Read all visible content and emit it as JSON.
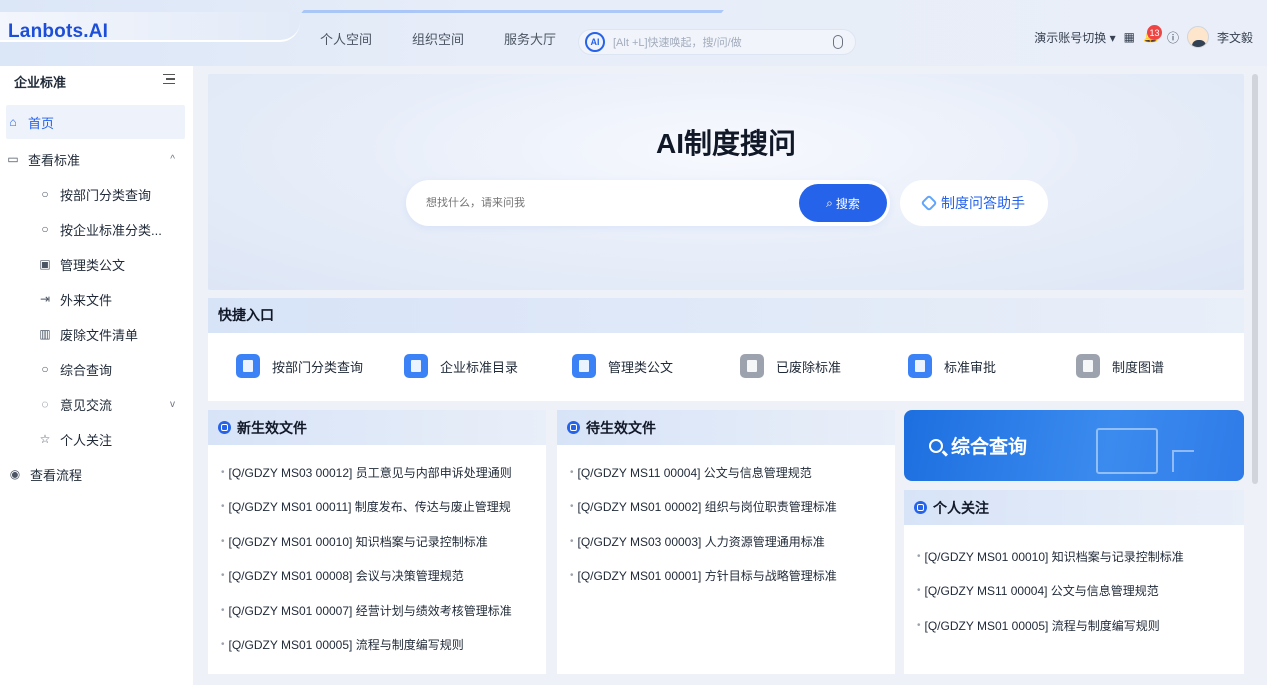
{
  "app": {
    "logo": "Lanbots.AI"
  },
  "topnav": {
    "items": [
      "个人空间",
      "组织空间",
      "服务大厅"
    ],
    "ai_badge": "AI",
    "ai_placeholder": "[Alt +L]快速唤起，搜/问/做",
    "account_switch": "演示账号切换 ▾",
    "notification_count": "13",
    "user_name": "李文毅"
  },
  "sidebar": {
    "title": "企业标准",
    "items": [
      {
        "label": "首页",
        "icon": "home-icon"
      },
      {
        "label": "查看标准",
        "icon": "folder-icon",
        "caret": "^"
      },
      {
        "label": "按部门分类查询",
        "icon": "search-icon"
      },
      {
        "label": "按企业标准分类...",
        "icon": "search-icon"
      },
      {
        "label": "管理类公文",
        "icon": "document-icon"
      },
      {
        "label": "外来文件",
        "icon": "import-icon"
      },
      {
        "label": "废除文件清单",
        "icon": "trash-icon"
      },
      {
        "label": "综合查询",
        "icon": "search-icon"
      },
      {
        "label": "意见交流",
        "icon": "chat-icon",
        "caret": "v"
      },
      {
        "label": "个人关注",
        "icon": "star-icon"
      },
      {
        "label": "查看流程",
        "icon": "eye-icon"
      }
    ]
  },
  "hero": {
    "title": "AI制度搜问",
    "search_placeholder": "想找什么，请来问我",
    "search_button": "搜索",
    "assistant_button": "制度问答助手"
  },
  "quick": {
    "title": "快捷入口",
    "items": [
      {
        "label": "按部门分类查询",
        "color": "#3b82f6"
      },
      {
        "label": "企业标准目录",
        "color": "#3b82f6"
      },
      {
        "label": "管理类公文",
        "color": "#3b82f6"
      },
      {
        "label": "已废除标准",
        "color": "#9ca3af"
      },
      {
        "label": "标准审批",
        "color": "#3b82f6"
      },
      {
        "label": "制度图谱",
        "color": "#9ca3af"
      }
    ]
  },
  "new_docs": {
    "title": "新生效文件",
    "items": [
      "[Q/GDZY MS03 00012] 员工意见与内部申诉处理通则",
      "[Q/GDZY MS01 00011] 制度发布、传达与废止管理规",
      "[Q/GDZY MS01 00010] 知识档案与记录控制标准",
      "[Q/GDZY MS01 00008] 会议与决策管理规范",
      "[Q/GDZY MS01 00007] 经营计划与绩效考核管理标准",
      "[Q/GDZY MS01 00005] 流程与制度编写规则"
    ]
  },
  "pending_docs": {
    "title": "待生效文件",
    "items": [
      "[Q/GDZY MS11 00004] 公文与信息管理规范",
      "[Q/GDZY MS01 00002] 组织与岗位职责管理标准",
      "[Q/GDZY MS03 00003] 人力资源管理通用标准",
      "[Q/GDZY MS01 00001] 方针目标与战略管理标准"
    ]
  },
  "combo_search": {
    "label": "综合查询"
  },
  "following": {
    "title": "个人关注",
    "items": [
      "[Q/GDZY MS01 00010] 知识档案与记录控制标准",
      "[Q/GDZY MS11 00004] 公文与信息管理规范",
      "[Q/GDZY MS01 00005] 流程与制度编写规则"
    ]
  }
}
